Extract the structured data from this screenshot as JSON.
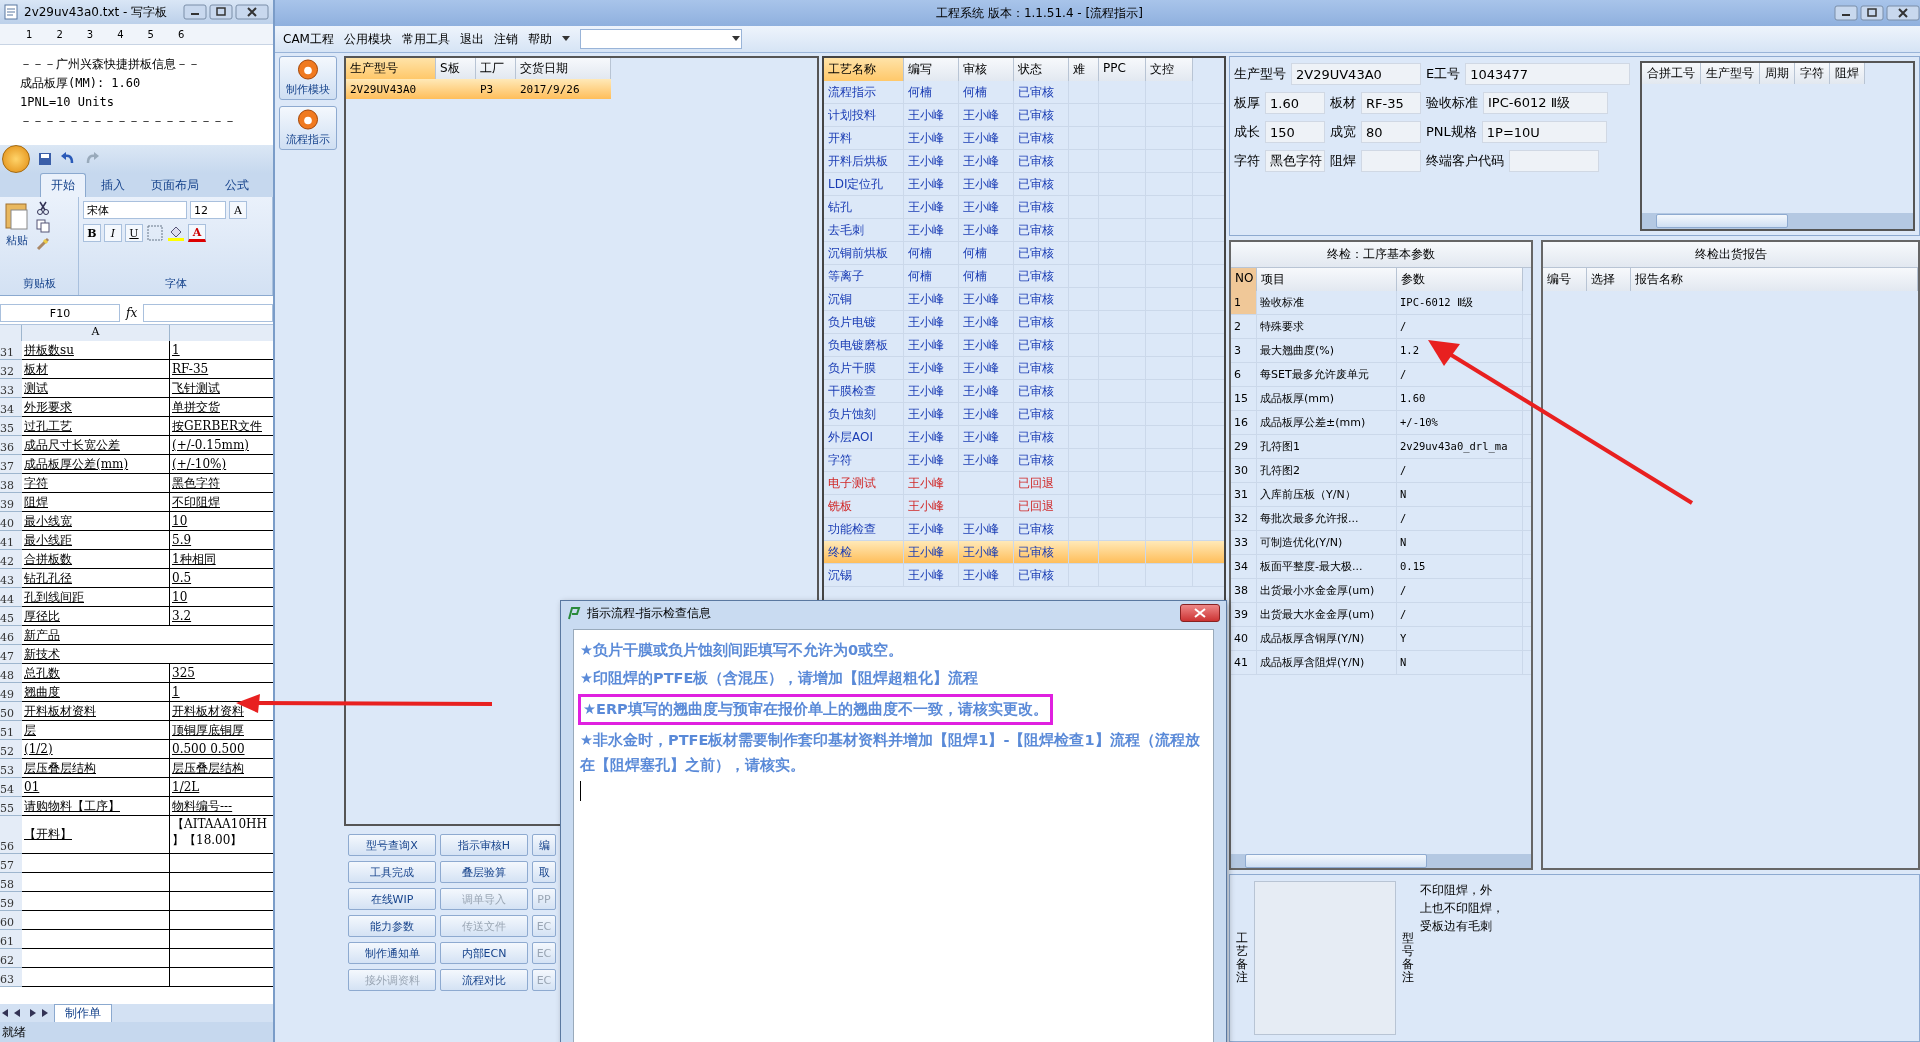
{
  "notepad": {
    "title": "2v29uv43a0.txt - 写字板",
    "ruler_marks": [
      "1",
      "2",
      "3",
      "4",
      "5",
      "6"
    ],
    "lines": [
      "－－－广州兴森快捷拼板信息－－",
      "成品板厚(MM): 1.60",
      "1PNL=10 Units",
      "－－－－－－－－－－－－－－－－－－"
    ]
  },
  "excel": {
    "tabs": [
      {
        "label": "开始",
        "selected": true
      },
      {
        "label": "插入",
        "selected": false
      },
      {
        "label": "页面布局",
        "selected": false
      },
      {
        "label": "公式",
        "selected": false
      }
    ],
    "paste_label": "粘贴",
    "clipboard_group": "剪贴板",
    "font_name": "宋体",
    "font_size": "12",
    "font_buttons": [
      "B",
      "I",
      "U"
    ],
    "font_color": "A",
    "grow_font": "A",
    "font_group": "字体",
    "name_box": "F10",
    "fx": "fx",
    "column_header": "A",
    "rows": [
      {
        "num": "31",
        "a": "拼板数su",
        "b": "1"
      },
      {
        "num": "32",
        "a": "板材",
        "b": "RF-35"
      },
      {
        "num": "33",
        "a": "测试",
        "b": "飞针测试"
      },
      {
        "num": "34",
        "a": "外形要求",
        "b": "单拼交货"
      },
      {
        "num": "35",
        "a": "过孔工艺",
        "b": "按GERBER文件"
      },
      {
        "num": "36",
        "a": "成品尺寸长宽公差",
        "b": "(+/-0.15mm)"
      },
      {
        "num": "37",
        "a": "成品板厚公差(mm)",
        "b": "(+/-10%)"
      },
      {
        "num": "38",
        "a": "字符",
        "b": "黑色字符"
      },
      {
        "num": "39",
        "a": "阻焊",
        "b": "不印阻焊"
      },
      {
        "num": "40",
        "a": "最小线宽",
        "b": "10"
      },
      {
        "num": "41",
        "a": "最小线距",
        "b": "5.9"
      },
      {
        "num": "42",
        "a": "合拼板数",
        "b": "1种相同"
      },
      {
        "num": "43",
        "a": "钻孔孔径",
        "b": "0.5"
      },
      {
        "num": "44",
        "a": "孔到线间距",
        "b": "10"
      },
      {
        "num": "45",
        "a": "厚径比",
        "b": "3.2"
      },
      {
        "num": "46",
        "a": "新产品",
        "merged": true
      },
      {
        "num": "47",
        "a": "新技术",
        "merged": true
      },
      {
        "num": "48",
        "a": "总孔数",
        "b": "325"
      },
      {
        "num": "49",
        "a": "翘曲度",
        "b": "1"
      },
      {
        "num": "50",
        "a": "开料板材资料",
        "b": "开料板材资料"
      },
      {
        "num": "51",
        "a": "层",
        "b": "顶铜厚底铜厚"
      },
      {
        "num": "52",
        "a": "(1/2)",
        "b": "0.500  0.500"
      },
      {
        "num": "53",
        "a": "层压叠层结构",
        "b": "层压叠层结构"
      },
      {
        "num": "54",
        "a": "01",
        "b": "1/2L"
      },
      {
        "num": "55",
        "a": "请购物料【工序】",
        "b": "物料编号---"
      },
      {
        "num": "56",
        "a": "【开料】",
        "b": "【AITAAA10HH",
        "b2": "】【18.00】",
        "tall": true
      },
      {
        "num": "57"
      },
      {
        "num": "58"
      },
      {
        "num": "59"
      },
      {
        "num": "60"
      },
      {
        "num": "61"
      },
      {
        "num": "62"
      },
      {
        "num": "63"
      }
    ],
    "sheet_tab": "制作单",
    "status": "就绪"
  },
  "app": {
    "title": "工程系统  版本：1.1.51.4 - [流程指示]",
    "menu": [
      "CAM工程",
      "公用模块",
      "常用工具",
      "退出",
      "注销",
      "帮助"
    ],
    "side_buttons": [
      "制作模块",
      "流程指示"
    ],
    "orders": {
      "columns": [
        "生产型号",
        "S板",
        "工厂",
        "交货日期"
      ],
      "rows": [
        {
          "model": "2V29UV43A0",
          "factory": "P3",
          "date": "2017/9/26",
          "selected": true
        }
      ]
    },
    "buttons": [
      [
        {
          "label": "型号查询X",
          "disabled": false
        },
        {
          "label": "指示审核H",
          "disabled": false
        },
        {
          "label": "编",
          "disabled": false
        }
      ],
      [
        {
          "label": "工具完成",
          "disabled": false
        },
        {
          "label": "叠层验算",
          "disabled": false
        },
        {
          "label": "取",
          "disabled": false
        }
      ],
      [
        {
          "label": "在线WIP",
          "disabled": false
        },
        {
          "label": "调单导入",
          "disabled": true
        },
        {
          "label": "PP",
          "disabled": true
        }
      ],
      [
        {
          "label": "能力参数",
          "disabled": false
        },
        {
          "label": "传送文件",
          "disabled": true
        },
        {
          "label": "EC",
          "disabled": true
        }
      ],
      [
        {
          "label": "制作通知单",
          "disabled": false
        },
        {
          "label": "内部ECN",
          "disabled": false
        },
        {
          "label": "EC",
          "disabled": true
        }
      ],
      [
        {
          "label": "接外调资料",
          "disabled": true
        },
        {
          "label": "流程对比",
          "disabled": false
        },
        {
          "label": "EC",
          "disabled": true
        }
      ]
    ],
    "process": {
      "columns": [
        "工艺名称",
        "编写",
        "审核",
        "状态",
        "难",
        "PPC",
        "文控"
      ],
      "rows": [
        {
          "name": "流程指示",
          "writer": "何楠",
          "reviewer": "何楠",
          "status": "已审核",
          "returned": false,
          "selected": false
        },
        {
          "name": "计划投料",
          "writer": "王小峰",
          "reviewer": "王小峰",
          "status": "已审核",
          "returned": false,
          "selected": false
        },
        {
          "name": "开料",
          "writer": "王小峰",
          "reviewer": "王小峰",
          "status": "已审核",
          "returned": false,
          "selected": false
        },
        {
          "name": "开料后烘板",
          "writer": "王小峰",
          "reviewer": "王小峰",
          "status": "已审核",
          "returned": false,
          "selected": false
        },
        {
          "name": "LDI定位孔",
          "writer": "王小峰",
          "reviewer": "王小峰",
          "status": "已审核",
          "returned": false,
          "selected": false
        },
        {
          "name": "钻孔",
          "writer": "王小峰",
          "reviewer": "王小峰",
          "status": "已审核",
          "returned": false,
          "selected": false
        },
        {
          "name": "去毛刺",
          "writer": "王小峰",
          "reviewer": "王小峰",
          "status": "已审核",
          "returned": false,
          "selected": false
        },
        {
          "name": "沉铜前烘板",
          "writer": "何楠",
          "reviewer": "何楠",
          "status": "已审核",
          "returned": false,
          "selected": false
        },
        {
          "name": "等离子",
          "writer": "何楠",
          "reviewer": "何楠",
          "status": "已审核",
          "returned": false,
          "selected": false
        },
        {
          "name": "沉铜",
          "writer": "王小峰",
          "reviewer": "王小峰",
          "status": "已审核",
          "returned": false,
          "selected": false
        },
        {
          "name": "负片电镀",
          "writer": "王小峰",
          "reviewer": "王小峰",
          "status": "已审核",
          "returned": false,
          "selected": false
        },
        {
          "name": "负电镀磨板",
          "writer": "王小峰",
          "reviewer": "王小峰",
          "status": "已审核",
          "returned": false,
          "selected": false
        },
        {
          "name": "负片干膜",
          "writer": "王小峰",
          "reviewer": "王小峰",
          "status": "已审核",
          "returned": false,
          "selected": false
        },
        {
          "name": "干膜检查",
          "writer": "王小峰",
          "reviewer": "王小峰",
          "status": "已审核",
          "returned": false,
          "selected": false
        },
        {
          "name": "负片蚀刻",
          "writer": "王小峰",
          "reviewer": "王小峰",
          "status": "已审核",
          "returned": false,
          "selected": false
        },
        {
          "name": "外层AOI",
          "writer": "王小峰",
          "reviewer": "王小峰",
          "status": "已审核",
          "returned": false,
          "selected": false
        },
        {
          "name": "字符",
          "writer": "王小峰",
          "reviewer": "王小峰",
          "status": "已审核",
          "returned": false,
          "selected": false
        },
        {
          "name": "电子测试",
          "writer": "王小峰",
          "status": "已回退",
          "returned": true,
          "selected": false
        },
        {
          "name": "铣板",
          "writer": "王小峰",
          "status": "已回退",
          "returned": true,
          "selected": false
        },
        {
          "name": "功能检查",
          "writer": "王小峰",
          "reviewer": "王小峰",
          "status": "已审核",
          "returned": false,
          "selected": false
        },
        {
          "name": "终检",
          "writer": "王小峰",
          "reviewer": "王小峰",
          "status": "已审核",
          "returned": false,
          "selected": true
        },
        {
          "name": "沉锡",
          "writer": "王小峰",
          "reviewer": "王小峰",
          "status": "已审核",
          "returned": false,
          "selected": false
        }
      ]
    },
    "form": [
      [
        {
          "label": "生产型号",
          "value": "2V29UV43A0"
        },
        {
          "label": "E工号",
          "value": "1043477"
        }
      ],
      [
        {
          "label": "板厚",
          "value": "1.60"
        },
        {
          "label": "板材",
          "value": "RF-35"
        },
        {
          "label": "验收标准",
          "value": "IPC-6012 Ⅱ级"
        }
      ],
      [
        {
          "label": "成长",
          "value": "150"
        },
        {
          "label": "成宽",
          "value": "80"
        },
        {
          "label": "PNL规格",
          "value": "1P=10U"
        }
      ],
      [
        {
          "label": "字符",
          "value": "黑色字符"
        },
        {
          "label": "阻焊"
        },
        {
          "label": "终端客户代码"
        }
      ]
    ],
    "merge_table": {
      "columns": [
        "合拼工号",
        "生产型号",
        "周期",
        "字符",
        "阻焊"
      ]
    },
    "params": {
      "title": "终检：工序基本参数",
      "columns": [
        "NO",
        "项目",
        "参数"
      ],
      "rows": [
        {
          "no": "1",
          "item": "验收标准",
          "value": "IPC-6012 Ⅱ级",
          "selected": true
        },
        {
          "no": "2",
          "item": "特殊要求",
          "value": "/",
          "selected": false
        },
        {
          "no": "3",
          "item": "最大翘曲度(%)",
          "value": "1.2",
          "selected": false
        },
        {
          "no": "6",
          "item": "每SET最多允许废单元",
          "value": "/",
          "selected": false
        },
        {
          "no": "15",
          "item": "成品板厚(mm)",
          "value": "1.60",
          "selected": false
        },
        {
          "no": "16",
          "item": "成品板厚公差±(mm)",
          "value": "+/-10%",
          "selected": false
        },
        {
          "no": "29",
          "item": "孔符图1",
          "value": "2v29uv43a0_drl_ma",
          "selected": false
        },
        {
          "no": "30",
          "item": "孔符图2",
          "value": "/",
          "selected": false
        },
        {
          "no": "31",
          "item": "入库前压板（Y/N）",
          "value": "N",
          "selected": false
        },
        {
          "no": "32",
          "item": "每批次最多允许报...",
          "value": "/",
          "selected": false
        },
        {
          "no": "33",
          "item": "可制造优化(Y/N)",
          "value": "N",
          "selected": false
        },
        {
          "no": "34",
          "item": "板面平整度-最大极...",
          "value": "0.15",
          "selected": false
        },
        {
          "no": "38",
          "item": "出货最小水金金厚(um)",
          "value": "/",
          "selected": false
        },
        {
          "no": "39",
          "item": "出货最大水金金厚(um)",
          "value": "/",
          "selected": false
        },
        {
          "no": "40",
          "item": "成品板厚含铜厚(Y/N)",
          "value": "Y",
          "selected": false
        },
        {
          "no": "41",
          "item": "成品板厚含阻焊(Y/N)",
          "value": "N",
          "selected": false
        }
      ]
    },
    "report": {
      "title": "终检出货报告",
      "columns": [
        "编号",
        "选择",
        "报告名称"
      ]
    },
    "notes": {
      "process_label": "工艺备注",
      "model_label": "型号备注",
      "model_lines": [
        "不印阻焊，外",
        "上也不印阻焊，",
        "受板边有毛刺"
      ]
    }
  },
  "dialog": {
    "title": "指示流程-指示检查信息",
    "lines": [
      {
        "text": "★负片干膜或负片蚀刻间距填写不允许为0或空。",
        "highlighted": false
      },
      {
        "text": "★印阻焊的PTFE板（含混压），请增加【阻焊超粗化】流程",
        "highlighted": false
      },
      {
        "text": "★ERP填写的翘曲度与预审在报价单上的翘曲度不一致，请核实更改。",
        "highlighted": true
      },
      {
        "text": "★非水金时，PTFE板材需要制作套印基材资料并增加【阻焊1】-【阻焊检查1】流程（流程放在【阻焊塞孔】之前），请核实。",
        "highlighted": false
      }
    ]
  }
}
